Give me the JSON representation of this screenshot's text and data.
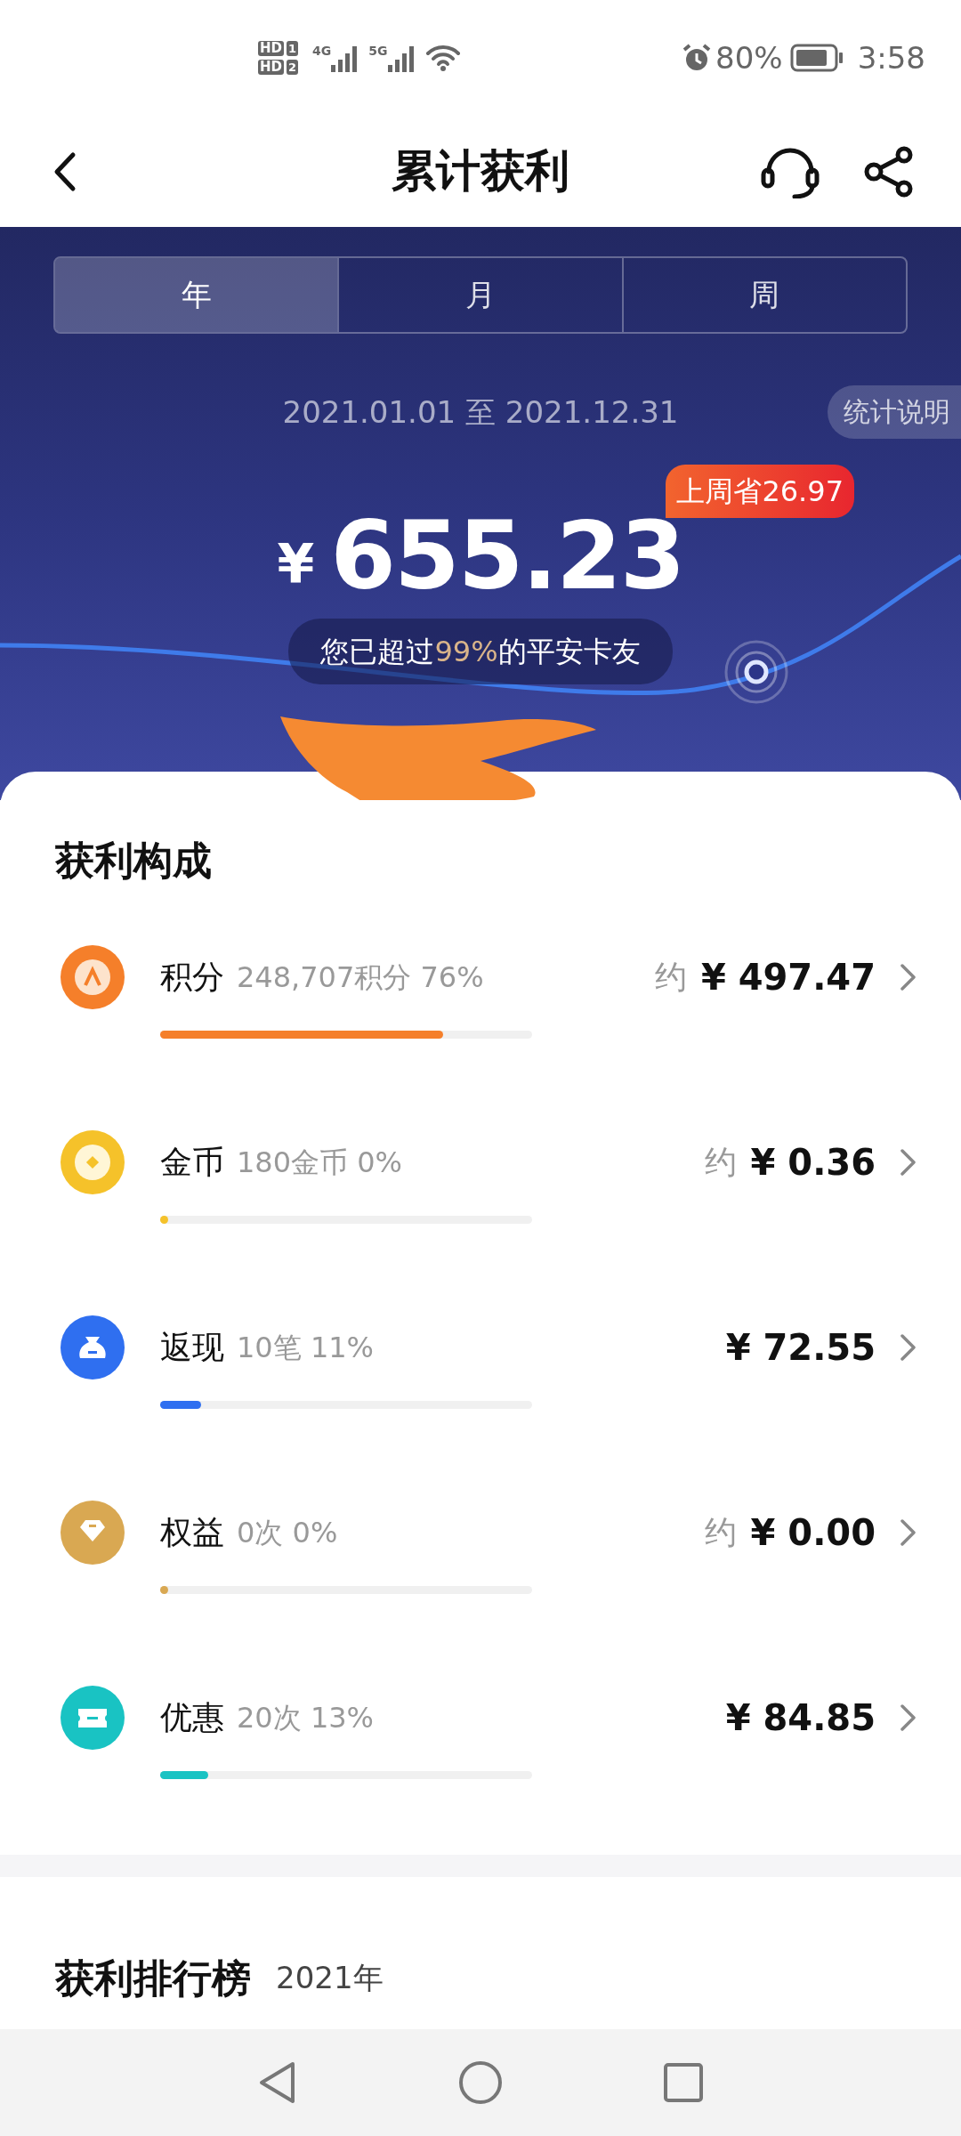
{
  "status_bar": {
    "sims": [
      {
        "label": "HD",
        "slot": "1"
      },
      {
        "label": "HD",
        "slot": "2"
      }
    ],
    "networks": [
      "4G",
      "5G"
    ],
    "battery": "80%",
    "time": "3:58"
  },
  "header": {
    "title": "累计获利"
  },
  "tabs": [
    {
      "label": "年",
      "selected": true
    },
    {
      "label": "月",
      "selected": false
    },
    {
      "label": "周",
      "selected": false
    }
  ],
  "period": {
    "range": "2021.01.01 至 2021.12.31",
    "explain": "统计说明"
  },
  "summary": {
    "weekly_badge": "上周省26.97",
    "currency": "¥",
    "total": "655.23",
    "rank_note": "您已超过**99%**的平安卡友"
  },
  "breakdown": {
    "title": "获利构成",
    "items": [
      {
        "kind": "points",
        "color": "#f57f2a",
        "name": "积分",
        "detail": "248,707积分 76%",
        "approx": "约",
        "amount": "¥ 497.47",
        "level": 0.76
      },
      {
        "kind": "coin",
        "color": "#f5c22a",
        "name": "金币",
        "detail": "180金币 0%",
        "approx": "约",
        "amount": "¥ 0.36",
        "level": 0
      },
      {
        "kind": "cash",
        "color": "#2f6ff0",
        "name": "返现",
        "detail": "10笔 11%",
        "amount": "¥ 72.55",
        "level": 0.11
      },
      {
        "kind": "rights",
        "color": "#d9a852",
        "name": "权益",
        "detail": "0次 0%",
        "approx": "约",
        "amount": "¥ 0.00",
        "level": 0
      },
      {
        "kind": "coupon",
        "color": "#19c3c3",
        "name": "优惠",
        "detail": "20次 13%",
        "amount": "¥ 84.85",
        "level": 0.13
      }
    ]
  },
  "ranking": {
    "title": "获利排行榜",
    "year": "2021年"
  }
}
